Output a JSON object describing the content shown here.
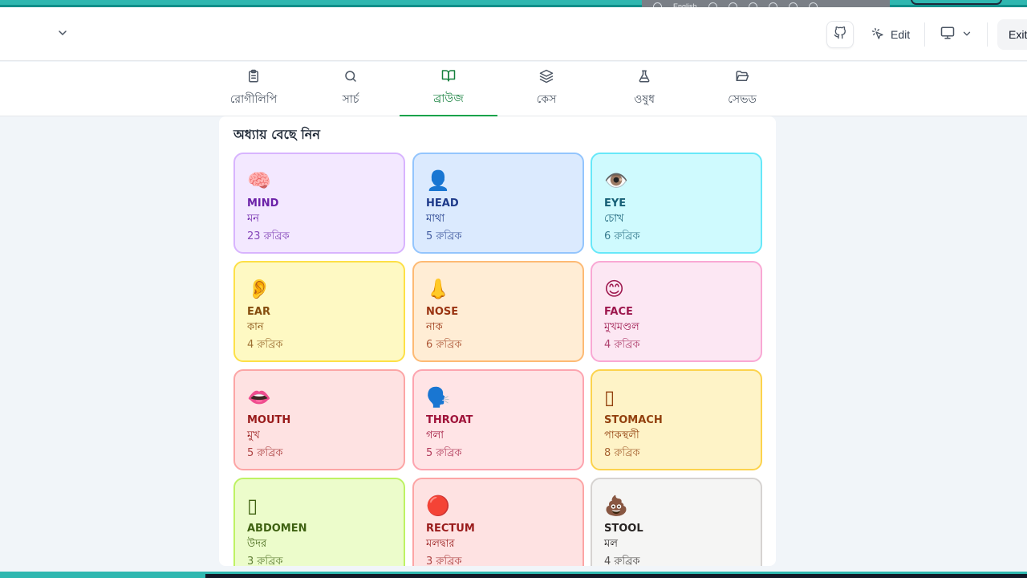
{
  "os_bar": {
    "language": "English"
  },
  "header": {
    "edit_label": "Edit",
    "exit_label": "Exit"
  },
  "tabs": [
    {
      "label": "রোগীলিপি",
      "icon": "clipboard-icon"
    },
    {
      "label": "সার্চ",
      "icon": "search-icon"
    },
    {
      "label": "ব্রাউজ",
      "icon": "book-open-icon",
      "active": true
    },
    {
      "label": "কেস",
      "icon": "layers-icon"
    },
    {
      "label": "ওষুধ",
      "icon": "flask-icon"
    },
    {
      "label": "সেভড",
      "icon": "folder-open-icon"
    }
  ],
  "browse": {
    "title": "অধ্যায় বেছে নিন",
    "chapters": [
      {
        "emoji": "🧠",
        "en": "MIND",
        "bn": "মন",
        "count": "23 রুব্রিক",
        "bg": "#f3e8ff",
        "border": "#d8b4fe",
        "text": "#6b21a8"
      },
      {
        "emoji": "👤",
        "en": "HEAD",
        "bn": "মাথা",
        "count": "5 রুব্রিক",
        "bg": "#dbeafe",
        "border": "#93c5fd",
        "text": "#1e3a8a"
      },
      {
        "emoji": "👁️",
        "en": "EYE",
        "bn": "চোখ",
        "count": "6 রুব্রিক",
        "bg": "#cffafe",
        "border": "#67e8f9",
        "text": "#155e75"
      },
      {
        "emoji": "👂",
        "en": "EAR",
        "bn": "কান",
        "count": "4 রুব্রিক",
        "bg": "#fef9c3",
        "border": "#fde047",
        "text": "#854d0e"
      },
      {
        "emoji": "👃",
        "en": "NOSE",
        "bn": "নাক",
        "count": "6 রুব্রিক",
        "bg": "#ffedd5",
        "border": "#fdba74",
        "text": "#9a3412"
      },
      {
        "emoji": "😊",
        "en": "FACE",
        "bn": "মুখমণ্ডল",
        "count": "4 রুব্রিক",
        "bg": "#fce7f3",
        "border": "#f9a8d4",
        "text": "#9d174d"
      },
      {
        "emoji": "👄",
        "en": "MOUTH",
        "bn": "মুখ",
        "count": "5 রুব্রিক",
        "bg": "#fee2e2",
        "border": "#fca5a5",
        "text": "#991b1b"
      },
      {
        "emoji": "🗣️",
        "en": "THROAT",
        "bn": "গলা",
        "count": "5 রুব্রিক",
        "bg": "#ffe4e6",
        "border": "#fda4af",
        "text": "#9f1239"
      },
      {
        "emoji": "▯",
        "en": "STOMACH",
        "bn": "পাকস্থলী",
        "count": "8 রুব্রিক",
        "bg": "#fef3c7",
        "border": "#fcd34d",
        "text": "#92400e"
      },
      {
        "emoji": "▯",
        "en": "ABDOMEN",
        "bn": "উদর",
        "count": "3 রুব্রিক",
        "bg": "#ecfccb",
        "border": "#bef264",
        "text": "#3f6212"
      },
      {
        "emoji": "🔴",
        "en": "RECTUM",
        "bn": "মলদ্বার",
        "count": "3 রুব্রিক",
        "bg": "#fee2e2",
        "border": "#fca5a5",
        "text": "#991b1b"
      },
      {
        "emoji": "💩",
        "en": "STOOL",
        "bn": "মল",
        "count": "4 রুব্রিক",
        "bg": "#f5f5f4",
        "border": "#d6d3d1",
        "text": "#292524"
      }
    ]
  }
}
